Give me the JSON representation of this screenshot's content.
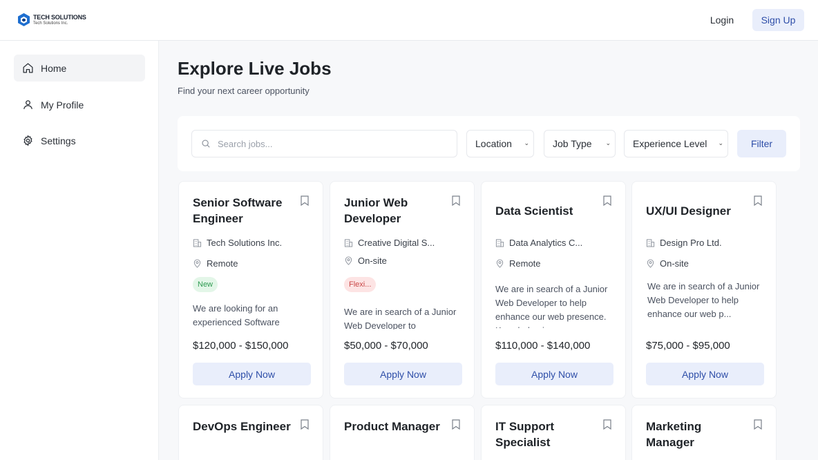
{
  "brand": {
    "title": "TECH SOLUTIONS",
    "subtitle": "Tech Solutions Inc."
  },
  "header": {
    "login_label": "Login",
    "signup_label": "Sign Up"
  },
  "sidebar": {
    "items": [
      {
        "label": "Home",
        "icon": "home-icon",
        "active": true
      },
      {
        "label": "My Profile",
        "icon": "user-icon",
        "active": false
      },
      {
        "label": "Settings",
        "icon": "gear-icon",
        "active": false
      }
    ]
  },
  "main": {
    "title": "Explore Live Jobs",
    "subtitle": "Find your next career opportunity"
  },
  "filters": {
    "search_placeholder": "Search jobs...",
    "location": "Location",
    "job_type": "Job Type",
    "experience": "Experience Level",
    "filter_label": "Filter"
  },
  "jobs": [
    {
      "title": "Senior Software Engineer",
      "company": "Tech Solutions Inc.",
      "location": "Remote",
      "badge": "New",
      "description": "We are looking for an experienced Software",
      "salary": "$120,000 - $150,000",
      "apply": "Apply Now"
    },
    {
      "title": "Junior Web Developer",
      "company": "Creative Digital S...",
      "location": "On-site",
      "badge": "Flexi...",
      "description": "We are in search of a Junior Web Developer to",
      "salary": "$50,000 - $70,000",
      "apply": "Apply Now"
    },
    {
      "title": "Data Scientist",
      "company": "Data Analytics C...",
      "location": "Remote",
      "description": "We are in search of a Junior Web Developer to help enhance our web presence. Knowledge in",
      "salary": "$110,000 - $140,000",
      "apply": "Apply Now"
    },
    {
      "title": "UX/UI Designer",
      "company": "Design Pro Ltd.",
      "location": "On-site",
      "description": "We are in search of a Junior Web Developer to help enhance our web p...",
      "salary": "$75,000 - $95,000",
      "apply": "Apply Now"
    },
    {
      "title": "DevOps Engineer"
    },
    {
      "title": "Product Manager"
    },
    {
      "title": "IT Support Specialist"
    },
    {
      "title": "Marketing Manager"
    }
  ],
  "colors": {
    "accent": "#2e4ea8",
    "accent_bg": "#e9eefb",
    "new_badge": "#2f9b52",
    "flex_badge": "#c94646"
  }
}
